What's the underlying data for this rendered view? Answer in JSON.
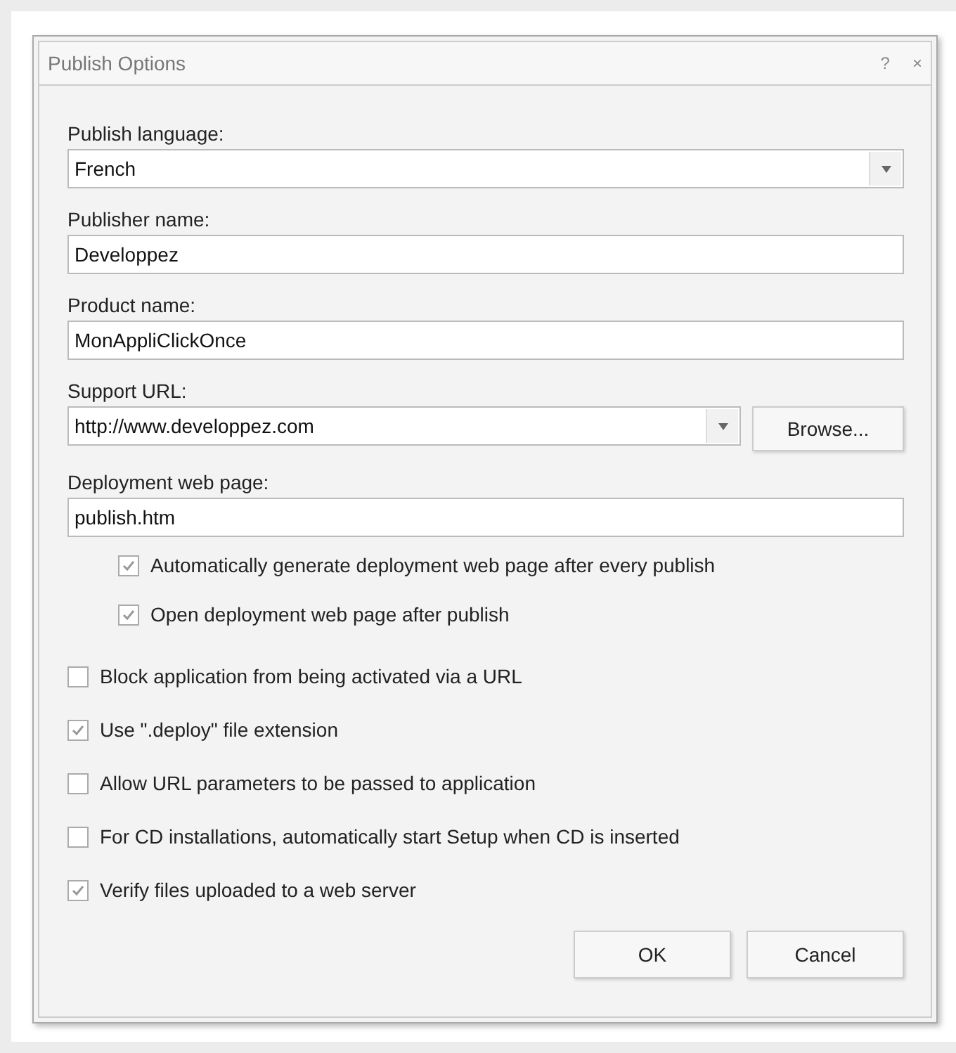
{
  "window": {
    "title": "Publish Options",
    "help": "?",
    "close": "×"
  },
  "fields": [
    {
      "kind": "combo",
      "label": "Publish language:",
      "value": "French"
    },
    {
      "kind": "text",
      "label": "Publisher name:",
      "value": "Developpez"
    },
    {
      "kind": "text",
      "label": "Product name:",
      "value": "MonAppliClickOnce"
    },
    {
      "kind": "combo_browse",
      "label": "Support URL:",
      "value": "http://www.developpez.com",
      "button": "Browse..."
    },
    {
      "kind": "text",
      "label": "Deployment web page:",
      "value": "publish.htm",
      "options": [
        {
          "label": "Automatically generate deployment web page after every publish",
          "checked": true
        },
        {
          "label": "Open deployment web page after publish",
          "checked": true
        }
      ]
    }
  ],
  "checkboxes": [
    {
      "label": "Block application from being activated via a URL",
      "checked": false
    },
    {
      "label": "Use \".deploy\" file extension",
      "checked": true
    },
    {
      "label": "Allow URL parameters to be passed to application",
      "checked": false
    },
    {
      "label": "For CD installations, automatically start Setup when CD is inserted",
      "checked": false
    },
    {
      "label": "Verify files uploaded to a web server",
      "checked": true
    }
  ],
  "buttons": [
    "OK",
    "Cancel"
  ]
}
